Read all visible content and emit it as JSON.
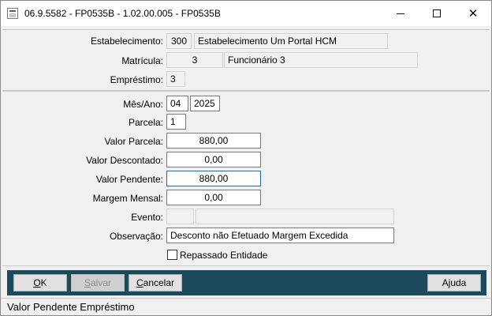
{
  "window": {
    "title": "06.9.5582 - FP0535B - 1.02.00.005 - FP0535B",
    "minimize_glyph": "",
    "maximize_glyph": "",
    "close_glyph": "✕"
  },
  "header_section": {
    "estabelecimento": {
      "label": "Estabelecimento:",
      "code": "300",
      "name": "Estabelecimento Um Portal HCM"
    },
    "matricula": {
      "label": "Matrícula:",
      "code": "3",
      "name": "Funcionário 3"
    },
    "emprestimo": {
      "label": "Empréstimo:",
      "value": "3"
    }
  },
  "form": {
    "mes_ano": {
      "label": "Mês/Ano:",
      "mes": "04",
      "ano": "2025"
    },
    "parcela": {
      "label": "Parcela:",
      "value": "1"
    },
    "valor_parcela": {
      "label": "Valor Parcela:",
      "value": "880,00"
    },
    "valor_descontado": {
      "label": "Valor Descontado:",
      "value": "0,00"
    },
    "valor_pendente": {
      "label": "Valor Pendente:",
      "value": "880,00"
    },
    "margem_mensal": {
      "label": "Margem Mensal:",
      "value": "0,00"
    },
    "evento": {
      "label": "Evento:",
      "code": "",
      "name": ""
    },
    "observacao": {
      "label": "Observação:",
      "value": "Desconto não Efetuado Margem Excedida"
    },
    "repassado": {
      "label": "Repassado Entidade",
      "checked": false
    }
  },
  "buttons": {
    "ok": {
      "mnemonic": "O",
      "rest": "K"
    },
    "salvar": {
      "mnemonic": "S",
      "rest": "alvar"
    },
    "cancelar": {
      "mnemonic": "C",
      "rest": "ancelar"
    },
    "ajuda": {
      "pre": "A",
      "mnemonic": "j",
      "rest": "uda"
    }
  },
  "status": {
    "text": "Valor Pendente Empréstimo"
  },
  "colors": {
    "footer_bg": "#1b4a5c",
    "focus_border": "#1b6fb8"
  },
  "icons": [
    "app-icon",
    "minimize-icon",
    "maximize-icon",
    "close-icon",
    "checkbox-icon"
  ]
}
